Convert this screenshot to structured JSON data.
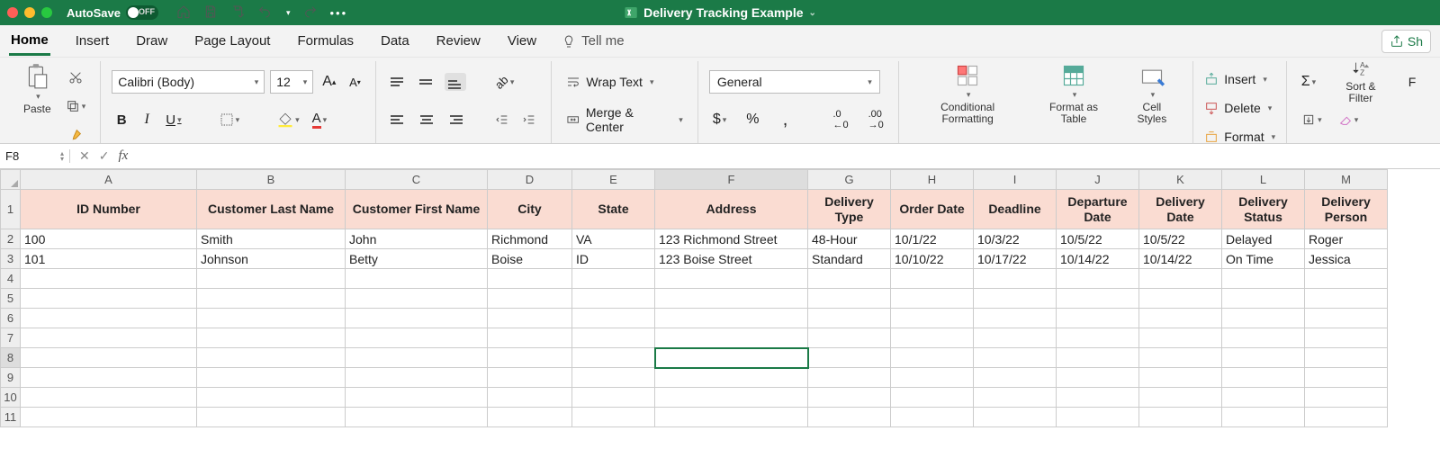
{
  "titlebar": {
    "autosave_label": "AutoSave",
    "autosave_state": "OFF",
    "doc_title": "Delivery Tracking Example"
  },
  "tabs": [
    "Home",
    "Insert",
    "Draw",
    "Page Layout",
    "Formulas",
    "Data",
    "Review",
    "View"
  ],
  "active_tab": "Home",
  "tell_me": "Tell me",
  "share": "Sh",
  "ribbon": {
    "paste": "Paste",
    "font_name": "Calibri (Body)",
    "font_size": "12",
    "bold": "B",
    "italic": "I",
    "underline": "U",
    "wrap": "Wrap Text",
    "merge": "Merge & Center",
    "number_format": "General",
    "cond_fmt": "Conditional Formatting",
    "fmt_table": "Format as Table",
    "cell_styles": "Cell Styles",
    "insert": "Insert",
    "delete": "Delete",
    "format": "Format",
    "sort_filter": "Sort & Filter"
  },
  "name_box": "F8",
  "columns": [
    "A",
    "B",
    "C",
    "D",
    "E",
    "F",
    "G",
    "H",
    "I",
    "J",
    "K",
    "L",
    "M"
  ],
  "col_widths": [
    "col-A",
    "col-B",
    "col-C",
    "col-D",
    "col-E",
    "col-F",
    "col-G",
    "col-H",
    "col-I",
    "col-J",
    "col-K",
    "col-L",
    "col-M"
  ],
  "selected": {
    "row": 8,
    "col": "F",
    "col_index": 5
  },
  "headers": [
    "ID Number",
    "Customer Last Name",
    "Customer First Name",
    "City",
    "State",
    "Address",
    "Delivery Type",
    "Order Date",
    "Deadline",
    "Departure Date",
    "Delivery Date",
    "Delivery Status",
    "Delivery Person"
  ],
  "rows": [
    [
      "100",
      "Smith",
      "John",
      "Richmond",
      "VA",
      "123 Richmond Street",
      "48-Hour",
      "10/1/22",
      "10/3/22",
      "10/5/22",
      "10/5/22",
      "Delayed",
      "Roger"
    ],
    [
      "101",
      "Johnson",
      "Betty",
      "Boise",
      "ID",
      "123 Boise Street",
      "Standard",
      "10/10/22",
      "10/17/22",
      "10/14/22",
      "10/14/22",
      "On Time",
      "Jessica"
    ]
  ],
  "visible_row_count": 11
}
